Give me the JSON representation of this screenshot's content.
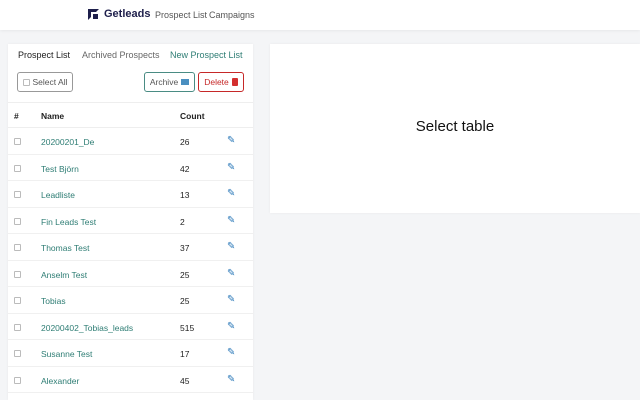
{
  "header": {
    "brand": "Getleads",
    "nav": [
      "Prospect List",
      "Campaigns"
    ]
  },
  "tabs": [
    "Prospect List",
    "Archived Prospects",
    "New Prospect List"
  ],
  "toolbar": {
    "select_all": "Select All",
    "archive": "Archive",
    "delete": "Delete"
  },
  "table": {
    "headers": [
      "#",
      "Name",
      "Count"
    ],
    "rows": [
      {
        "name": "20200201_De",
        "count": "26"
      },
      {
        "name": "Test Björn",
        "count": "42"
      },
      {
        "name": "Leadliste",
        "count": "13"
      },
      {
        "name": "Fin Leads Test",
        "count": "2"
      },
      {
        "name": "Thomas Test",
        "count": "37"
      },
      {
        "name": "Anselm Test",
        "count": "25"
      },
      {
        "name": "Tobias",
        "count": "25"
      },
      {
        "name": "20200402_Tobias_leads",
        "count": "515"
      },
      {
        "name": "Susanne Test",
        "count": "17"
      },
      {
        "name": "Alexander",
        "count": "45"
      }
    ]
  },
  "main": {
    "placeholder": "Select table"
  },
  "colors": {
    "accent": "#2e7d74",
    "danger": "#c62828",
    "brand": "#1e1f4b"
  }
}
